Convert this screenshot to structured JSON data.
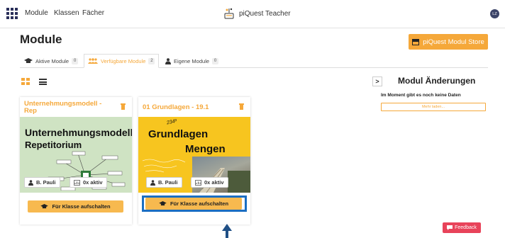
{
  "header": {
    "nav": [
      "Module",
      "Klassen",
      "Fächer"
    ],
    "brand": "piQuest Teacher",
    "avatar": "LZ"
  },
  "page": {
    "title": "Module",
    "store_button": "piQuest Modul Store"
  },
  "tabs": [
    {
      "label": "Aktive Module",
      "count": "0",
      "icon": "graduation-cap-icon"
    },
    {
      "label": "Verfügbare Module",
      "count": "2",
      "icon": "users-icon"
    },
    {
      "label": "Eigene Module",
      "count": "0",
      "icon": "user-icon"
    }
  ],
  "cards": [
    {
      "title": "Unternehmungsmodell - Rep",
      "thumb_lines": [
        "Unternehmungsmodell",
        "Repetitorium"
      ],
      "owner": "B. Pauli",
      "activity": "0x aktiv",
      "button": "Für Klasse aufschalten"
    },
    {
      "title": "01 Grundlagen - 19.1",
      "thumb_lines": [
        "Grundlagen",
        "Mengen"
      ],
      "thumb_scribble": "234⁹",
      "owner": "B. Pauli",
      "activity": "0x aktiv",
      "button": "Für Klasse aufschalten"
    }
  ],
  "panel": {
    "toggle": ">",
    "title": "Modul Änderungen",
    "empty_text": "Im Moment gibt es noch keine Daten",
    "more_button": "Mehr laden..."
  },
  "feedback": "Feedback",
  "colors": {
    "accent": "#f5a83a",
    "highlight": "#1b6ec2",
    "feedback": "#e8435a",
    "thumb_green": "#cfe3c3",
    "thumb_yellow": "#f7c51f"
  }
}
